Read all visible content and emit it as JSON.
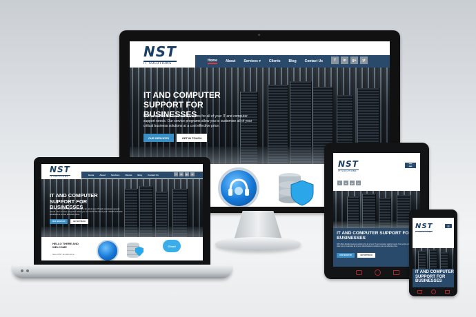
{
  "brand": {
    "logo": "NST",
    "tagline": "IT SOLUTIONS"
  },
  "nav": {
    "items": [
      "Home",
      "About",
      "Services",
      "Clients",
      "Blog",
      "Contact Us"
    ],
    "services_caret": "▾"
  },
  "social": [
    "f",
    "in",
    "g+",
    "yt"
  ],
  "hero": {
    "title": "IT AND COMPUTER SUPPORT FOR BUSINESSES",
    "text": "NST offers flexible business solutions for all of your IT and computer support needs. Our service programs allow you to customise all of your critical business solutions at a cost effective price.",
    "primary_button": "OUR SERVICES",
    "secondary_button": "GET IN TOUCH"
  },
  "laptop_sections": {
    "welcome_title": "HELLO THERE AND WELCOME",
    "welcome_text": "here at NST, we want our se...",
    "cloud_label": "Cloud"
  },
  "menu_icon": "☰",
  "colors": {
    "navy": "#2a4a6b",
    "accent_blue": "#3a8fc4",
    "active_red": "#e23a3a"
  }
}
